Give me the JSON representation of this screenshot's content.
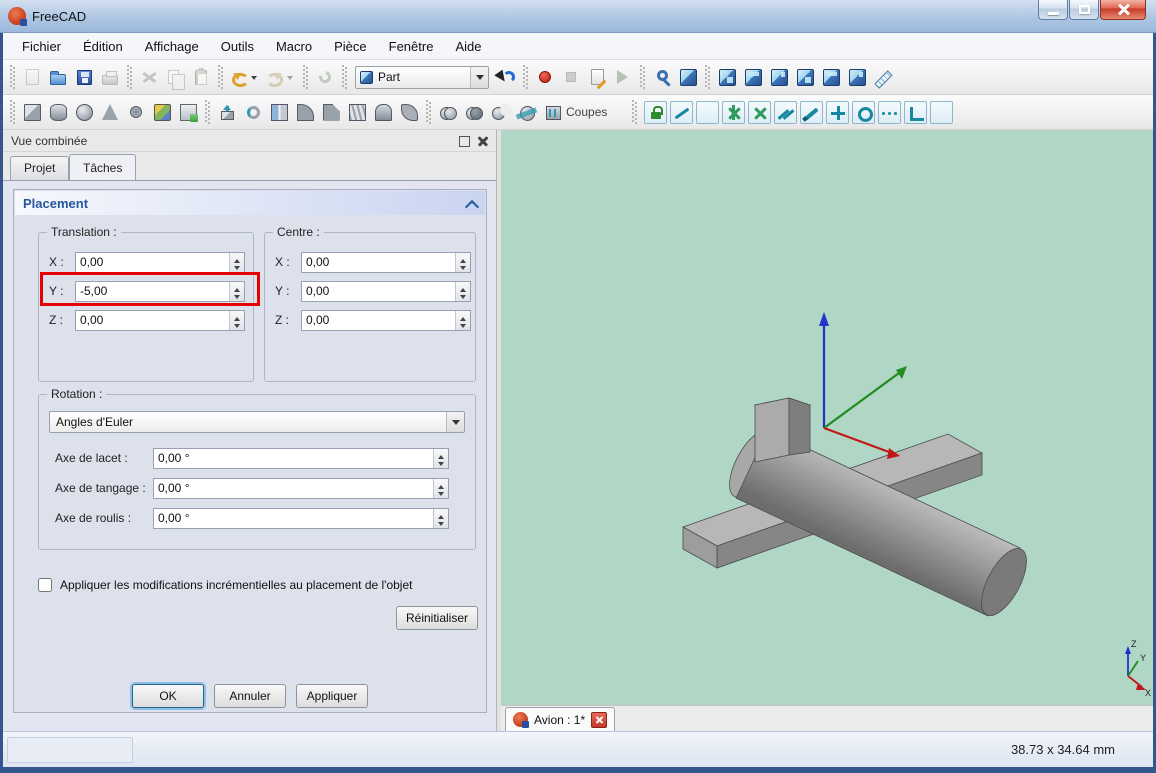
{
  "window": {
    "title": "FreeCAD"
  },
  "colors": {
    "viewport_background": "#b0d6c6",
    "highlight": "#e60000",
    "selection_accent": "#3c7fb1"
  },
  "menu_bar": {
    "items": [
      "Fichier",
      "Édition",
      "Affichage",
      "Outils",
      "Macro",
      "Pièce",
      "Fenêtre",
      "Aide"
    ]
  },
  "toolbars": {
    "workbench_selected": "Part",
    "coupes_label": "Coupes",
    "row1_icons": [
      "new-file-icon",
      "open-file-icon",
      "save-icon",
      "print-icon",
      "cut-icon",
      "copy-icon",
      "paste-icon",
      "undo-icon",
      "redo-icon",
      "refresh-icon",
      "workbench-selector",
      "whats-this-icon",
      "macro-record-icon",
      "macro-stop-icon",
      "macro-edit-icon",
      "macro-play-icon",
      "fit-all-icon",
      "axonometric-view-icon",
      "front-view-icon",
      "top-view-icon",
      "right-view-icon",
      "rear-view-icon",
      "bottom-view-icon",
      "left-view-icon",
      "measure-distance-icon"
    ],
    "row2_icons": [
      "box-icon",
      "cylinder-icon",
      "sphere-icon",
      "cone-icon",
      "torus-icon",
      "primitives-icon",
      "shape-builder-icon",
      "extrude-icon",
      "revolve-icon",
      "mirror-icon",
      "fillet-icon",
      "chamfer-icon",
      "ruled-surface-icon",
      "loft-icon",
      "sweep-icon",
      "union-icon",
      "common-icon",
      "cut-boolean-icon",
      "section-icon",
      "cross-sections-icon"
    ],
    "measure_icons": [
      "measure-lock-icon",
      "measure-linear-icon",
      "measure-angular-icon",
      "measure-refresh-icon",
      "measure-clear-all-icon",
      "measure-toggle-all-icon",
      "measure-toggle-3d-icon",
      "measure-toggle-delta-icon",
      "datum-plus-icon",
      "datum-circle-icon",
      "more-measure-icon",
      "measure-small-icon"
    ]
  },
  "combo_view": {
    "title": "Vue combinée",
    "tabs": [
      "Projet",
      "Tâches"
    ],
    "active_tab": "Tâches"
  },
  "task_panel": {
    "section_title": "Placement",
    "translation": {
      "title": "Translation :",
      "rows": [
        {
          "label": "X :",
          "value": "0,00"
        },
        {
          "label": "Y :",
          "value": "-5,00"
        },
        {
          "label": "Z :",
          "value": "0,00"
        }
      ]
    },
    "centre": {
      "title": "Centre :",
      "rows": [
        {
          "label": "X :",
          "value": "0,00"
        },
        {
          "label": "Y :",
          "value": "0,00"
        },
        {
          "label": "Z :",
          "value": "0,00"
        }
      ]
    },
    "rotation": {
      "title": "Rotation :",
      "mode": "Angles d'Euler",
      "rows": [
        {
          "label": "Axe de lacet :",
          "value": "0,00 °"
        },
        {
          "label": "Axe de tangage :",
          "value": "0,00 °"
        },
        {
          "label": "Axe de roulis :",
          "value": "0,00 °"
        }
      ]
    },
    "incremental_label": "Appliquer les modifications incrémentielles au placement de l'objet",
    "reset_button": "Réinitialiser",
    "ok_button": "OK",
    "cancel_button": "Annuler",
    "apply_button": "Appliquer"
  },
  "viewport": {
    "document_tab": "Avion : 1*",
    "nav_axis": {
      "x": "X",
      "y": "Y",
      "z": "Z"
    }
  },
  "status_bar": {
    "dimensions": "38.73 x 34.64 mm"
  }
}
